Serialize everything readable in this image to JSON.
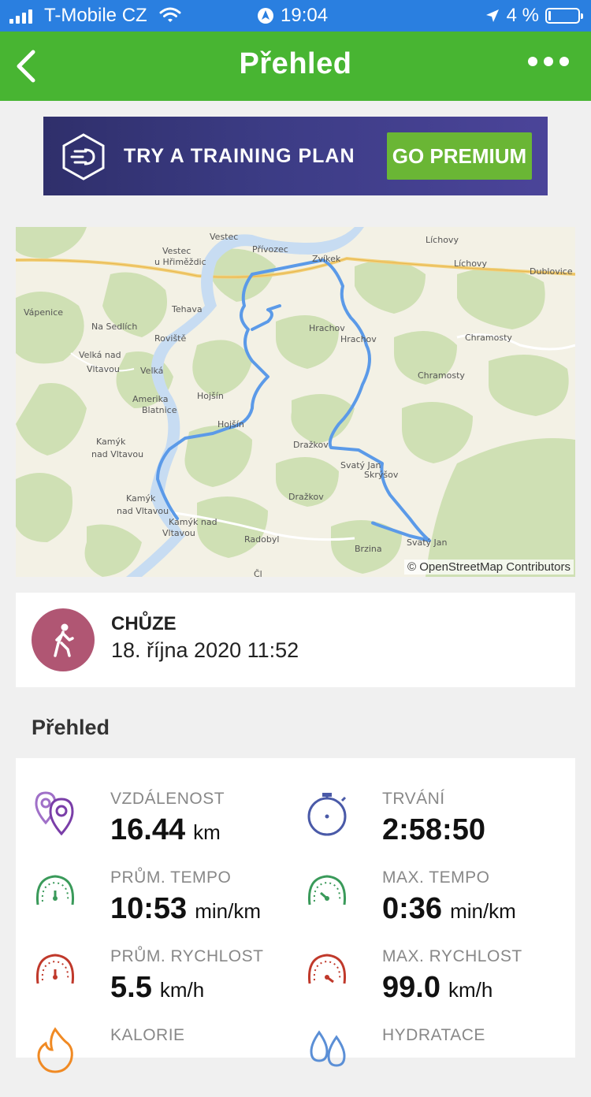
{
  "status_bar": {
    "carrier": "T-Mobile CZ",
    "time": "19:04",
    "battery": "4 %"
  },
  "header": {
    "title": "Přehled",
    "back_icon": "chevron-left-icon",
    "more_icon": "more-dots-icon"
  },
  "banner": {
    "title": "TRY A TRAINING PLAN",
    "cta": "GO PREMIUM"
  },
  "map": {
    "attribution": "© OpenStreetMap Contributors",
    "place_labels": [
      "Vestec",
      "Vestec",
      "u Hřiměždic",
      "Přívozec",
      "Zvíkek",
      "Líchovy",
      "Líchovy",
      "Dublovice",
      "Vápenice",
      "Na Sedlích",
      "Tehava",
      "Roviště",
      "Hrachov",
      "Hrachov",
      "Chramosty",
      "Velká nad",
      "Vltavou",
      "Velká",
      "Chramosty",
      "Amerika",
      "Blatnice",
      "Hojšín",
      "Hojšín",
      "Kamýk",
      "nad Vltavou",
      "Dražkov",
      "Svatý Jan",
      "Skrýšov",
      "Kamýk",
      "nad Vltavou",
      "Dražkov",
      "Kamýk nad",
      "Vltavou",
      "Radobyl",
      "Brzina",
      "Svatý Jan",
      "Čl"
    ]
  },
  "activity": {
    "type": "CHŮZE",
    "date": "18. října 2020 11:52",
    "icon": "walking-person-icon",
    "color": "#b05673"
  },
  "overview": {
    "title": "Přehled",
    "stats": [
      {
        "label": "VZDÁLENOST",
        "value": "16.44",
        "unit": "km",
        "icon": "distance-pins-icon"
      },
      {
        "label": "TRVÁNÍ",
        "value": "2:58:50",
        "unit": "",
        "icon": "stopwatch-icon"
      },
      {
        "label": "PRŮM. TEMPO",
        "value": "10:53",
        "unit": "min/km",
        "icon": "pace-gauge-icon"
      },
      {
        "label": "MAX. TEMPO",
        "value": "0:36",
        "unit": "min/km",
        "icon": "max-pace-gauge-icon"
      },
      {
        "label": "PRŮM. RYCHLOST",
        "value": "5.5",
        "unit": "km/h",
        "icon": "speed-gauge-icon"
      },
      {
        "label": "MAX. RYCHLOST",
        "value": "99.0",
        "unit": "km/h",
        "icon": "max-speed-gauge-icon"
      },
      {
        "label": "KALORIE",
        "value": "",
        "unit": "",
        "icon": "flame-icon"
      },
      {
        "label": "HYDRATACE",
        "value": "",
        "unit": "",
        "icon": "water-drops-icon"
      }
    ]
  },
  "colors": {
    "status_bar": "#2a7fe0",
    "header": "#48b532",
    "cta": "#6ab635",
    "route": "#5b9ae8",
    "river": "#c7dcf2"
  }
}
